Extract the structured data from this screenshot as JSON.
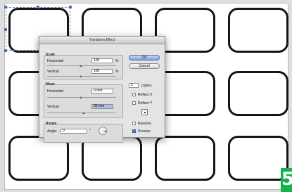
{
  "dialog": {
    "title": "Transform Effect",
    "scale": {
      "label": "Scale",
      "horizontal_label": "Horizontal:",
      "horizontal_value": "100",
      "horizontal_unit": "%",
      "vertical_label": "Vertical:",
      "vertical_value": "100",
      "vertical_unit": "%"
    },
    "move": {
      "label": "Move",
      "horizontal_label": "Horizontal:",
      "horizontal_value": "0 mm",
      "vertical_label": "Vertical:",
      "vertical_value": "35 mm"
    },
    "rotate": {
      "label": "Rotate",
      "angle_label": "Angle:",
      "angle_value": "0",
      "angle_unit": "°"
    },
    "ok_label": "OK",
    "cancel_label": "Cancel",
    "copies_value": "2",
    "copies_label": "copies",
    "reflect_x_label": "Reflect X",
    "reflect_x_checked": false,
    "reflect_y_label": "Reflect Y",
    "reflect_y_checked": false,
    "random_label": "Random",
    "random_checked": false,
    "preview_label": "Preview",
    "preview_checked": true
  },
  "logo_text": "5",
  "colors": {
    "dialog_bg": "#e4e4e4",
    "default_button": "#7ea2d8",
    "field_highlight": "#aebfe0",
    "shape_stroke": "#151515",
    "logo_green": "#14b24a"
  }
}
